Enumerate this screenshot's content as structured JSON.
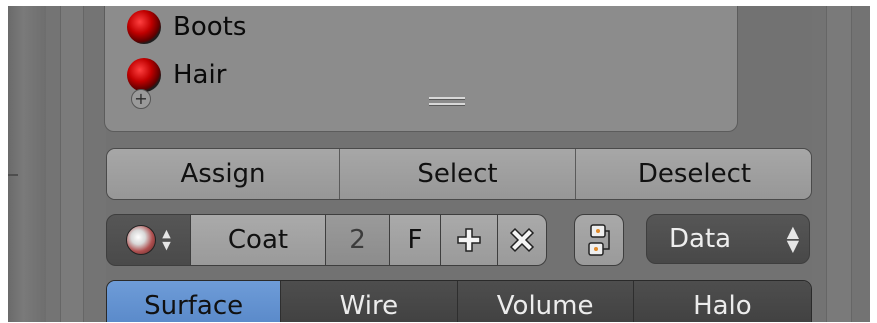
{
  "material_slots": [
    {
      "name": "Boots"
    },
    {
      "name": "Hair"
    }
  ],
  "slot_buttons": {
    "assign": "Assign",
    "select": "Select",
    "deselect": "Deselect"
  },
  "material_selector": {
    "name": "Coat",
    "users": "2",
    "fake_user": "F"
  },
  "link_dropdown": {
    "value": "Data",
    "arrows": "▴▾"
  },
  "icons": {
    "add_slot": "plus-circle-icon",
    "new_material": "plus-icon",
    "unlink": "x-icon",
    "browse": "material-sphere-icon",
    "data_link": "data-link-icon"
  },
  "preview_tabs": [
    "Surface",
    "Wire",
    "Volume",
    "Halo"
  ],
  "colors": {
    "active_tab": "#5a8ccb",
    "material_red": "#c00000"
  }
}
